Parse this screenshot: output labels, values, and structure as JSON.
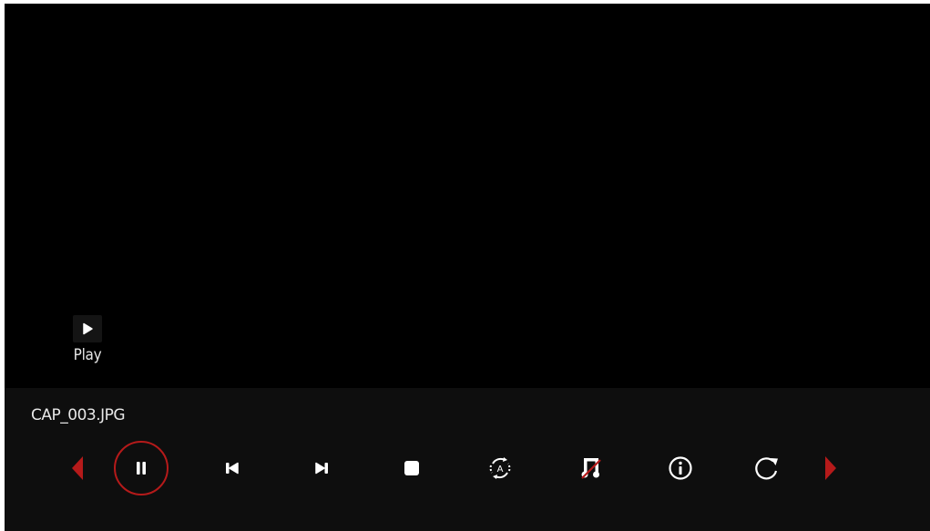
{
  "status": {
    "state_label": "Play",
    "state_icon": "play-icon"
  },
  "file": {
    "name": "CAP_003.JPG"
  },
  "controls": [
    {
      "name": "prev-page-arrow",
      "icon": "triangle-left-icon"
    },
    {
      "name": "pause-button",
      "icon": "pause-icon",
      "focused": true
    },
    {
      "name": "previous-button",
      "icon": "skip-previous-icon"
    },
    {
      "name": "next-button",
      "icon": "skip-next-icon"
    },
    {
      "name": "stop-button",
      "icon": "stop-icon"
    },
    {
      "name": "auto-rotate-button",
      "icon": "auto-rotate-icon"
    },
    {
      "name": "music-off-button",
      "icon": "music-off-icon"
    },
    {
      "name": "info-button",
      "icon": "info-icon"
    },
    {
      "name": "rotate-button",
      "icon": "rotate-clockwise-icon"
    },
    {
      "name": "next-page-arrow",
      "icon": "triangle-right-icon"
    }
  ],
  "colors": {
    "accent": "#b51a1a",
    "background": "#000000",
    "bar": "#0e0e0e",
    "text": "#e8e8e8"
  }
}
